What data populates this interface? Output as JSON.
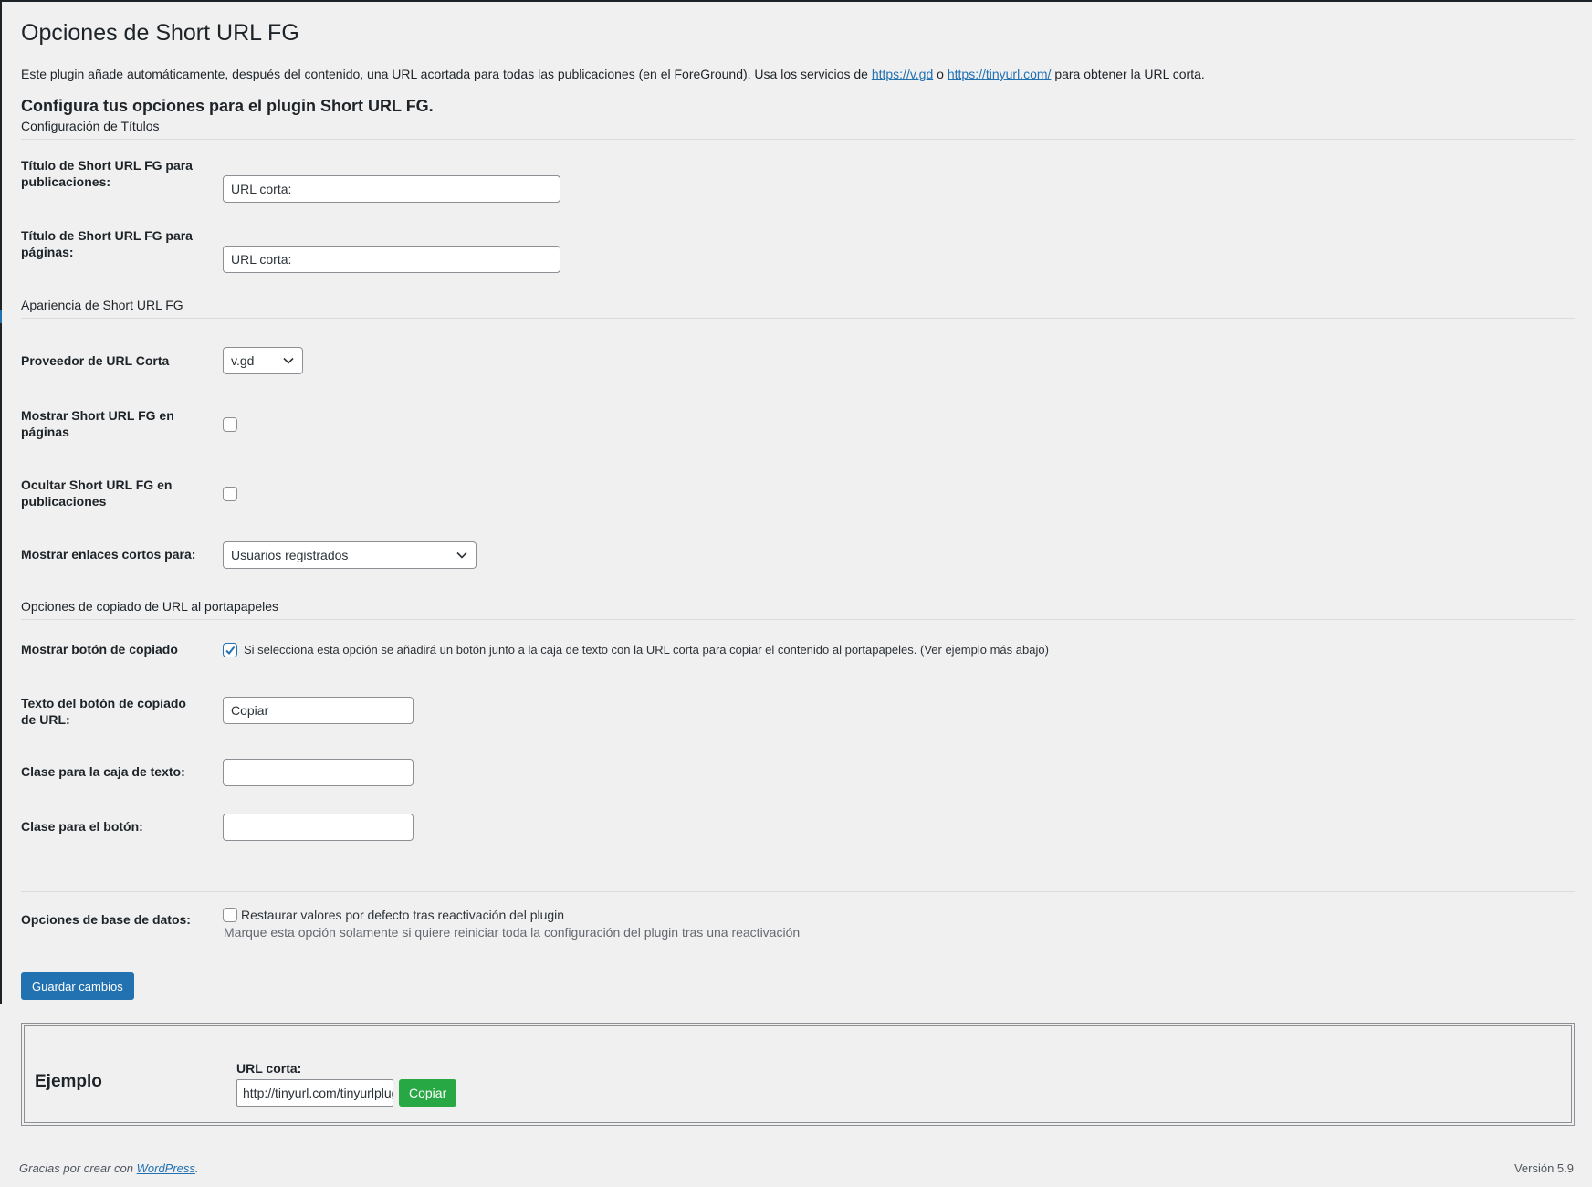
{
  "page": {
    "title": "Opciones de Short URL FG",
    "intro_before": "Este plugin añade automáticamente, después del contenido, una URL acortada para todas las publicaciones (en el ForeGround). Usa los servicios de ",
    "link_vgd": "https://v.gd",
    "intro_mid": " o ",
    "link_tinyurl": "https://tinyurl.com/",
    "intro_after": " para obtener la URL corta.",
    "config_heading": "Configura tus opciones para el plugin Short URL FG."
  },
  "sections": {
    "titles": "Configuración de Títulos",
    "appearance": "Apariencia de Short URL FG",
    "clipboard": "Opciones de copiado de URL al portapapeles"
  },
  "fields": {
    "posts_title_label": "Título de Short URL FG para publicaciones:",
    "posts_title_value": "URL corta:",
    "pages_title_label": "Título de Short URL FG para páginas:",
    "pages_title_value": "URL corta:",
    "provider_label": "Proveedor de URL Corta",
    "provider_value": "v.gd",
    "show_pages_label": "Mostrar Short URL FG en páginas",
    "show_pages_checked": false,
    "hide_posts_label": "Ocultar Short URL FG en publicaciones",
    "hide_posts_checked": false,
    "show_links_for_label": "Mostrar enlaces cortos para:",
    "show_links_for_value": "Usuarios registrados",
    "copy_button_label": "Mostrar botón de copiado",
    "copy_button_checked": true,
    "copy_button_desc": "Si selecciona esta opción se añadirá un botón junto a la caja de texto con la URL corta para copiar el contenido al portapapeles. (Ver ejemplo más abajo)",
    "copy_text_label": "Texto del botón de copiado de URL:",
    "copy_text_value": "Copiar",
    "textbox_class_label": "Clase para la caja de texto:",
    "textbox_class_value": "",
    "button_class_label": "Clase para el botón:",
    "button_class_value": "",
    "db_label": "Opciones de base de datos:",
    "db_checkbox_text": "Restaurar valores por defecto tras reactivación del plugin",
    "db_checked": false,
    "db_help": "Marque esta opción solamente si quiere reiniciar toda la configuración del plugin tras una reactivación"
  },
  "save_button": "Guardar cambios",
  "example": {
    "title": "Ejemplo",
    "label": "URL corta:",
    "url": "http://tinyurl.com/tinyurlplugin",
    "copy_button": "Copiar"
  },
  "footer": {
    "thanks": "Gracias por crear con ",
    "wp_link": "WordPress",
    "period": ".",
    "version": "Versión 5.9"
  },
  "colors": {
    "accent": "#2271b1",
    "copy_green": "#28a745",
    "background": "#f0f0f1"
  }
}
